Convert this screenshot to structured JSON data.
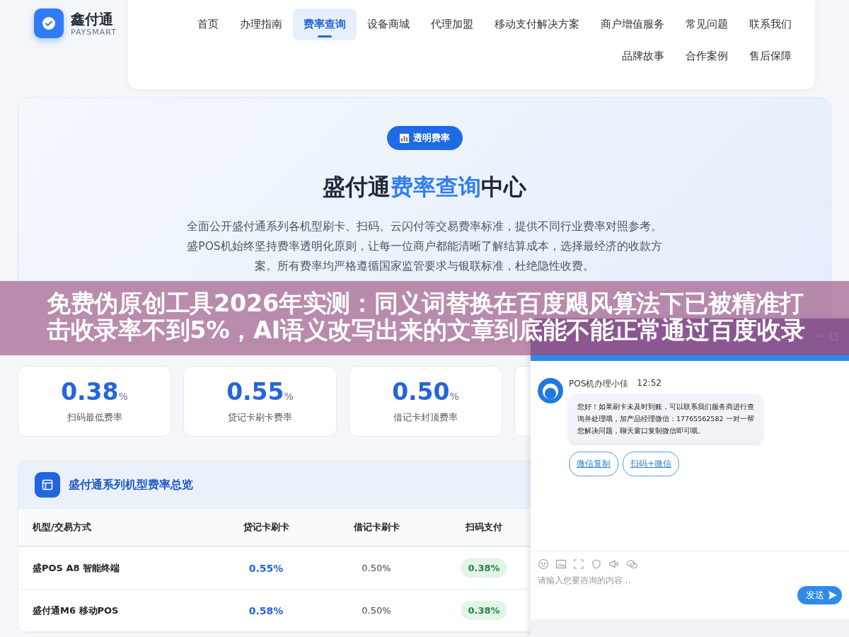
{
  "brand": {
    "name": "鑫付通",
    "tagline": "PAYSMART"
  },
  "nav": {
    "items": [
      {
        "label": "首页",
        "selected": false
      },
      {
        "label": "办理指南",
        "selected": false
      },
      {
        "label": "费率查询",
        "selected": true
      },
      {
        "label": "设备商城",
        "selected": false
      },
      {
        "label": "代理加盟",
        "selected": false
      },
      {
        "label": "移动支付解决方案",
        "selected": false
      },
      {
        "label": "商户增值服务",
        "selected": false
      },
      {
        "label": "常见问题",
        "selected": false
      },
      {
        "label": "联系我们",
        "selected": false
      },
      {
        "label": "品牌故事",
        "selected": false
      },
      {
        "label": "合作案例",
        "selected": false
      },
      {
        "label": "售后保障",
        "selected": false
      }
    ]
  },
  "hero": {
    "badge": "透明费率",
    "title": [
      {
        "text": "盛付通",
        "accent": false
      },
      {
        "text": "费率查询",
        "accent": true
      },
      {
        "text": "中心",
        "accent": false
      }
    ],
    "description": "全面公开盛付通系列各机型刷卡、扫码、云闪付等交易费率标准，提供不同行业费率对照参考。盛POS机始终坚持费率透明化原则，让每一位商户都能清晰了解结算成本，选择最经济的收款方案。所有费率均严格遵循国家监管要求与银联标准，杜绝隐性收费。"
  },
  "stats": [
    {
      "value": "0.38",
      "unit": "%",
      "label": "扫码最低费率"
    },
    {
      "value": "0.55",
      "unit": "%",
      "label": "贷记卡刷卡费率"
    },
    {
      "value": "0.50",
      "unit": "%",
      "label": "借记卡封顶费率"
    }
  ],
  "table": {
    "title": "盛付通系列机型费率总览",
    "columns": [
      "机型/交易方式",
      "贷记卡刷卡",
      "借记卡刷卡",
      "扫码支付"
    ],
    "rows": [
      [
        "盛POS A8 智能终端",
        "0.55%",
        "0.50%",
        "0.38%"
      ],
      [
        "盛付通M6 移动POS",
        "0.58%",
        "0.50%",
        "0.38%"
      ]
    ]
  },
  "banner": {
    "lines": [
      "免费伪原创工具2026年实测：同义词替换在百度飓风算法下已被精准打",
      "击收录率不到5%，AI语义改写出来的文章到底能不能正常通过百度收录"
    ]
  },
  "chat": {
    "agent": "POS机办理小佳",
    "time": "12:52",
    "message": "您好！如果刷卡未及时到账，可以联系我们服务商进行查询并处理哦，加产品经理微信：17765562582 一对一帮您解决问题，聊天窗口复制微信即可哦。",
    "quick_replies": [
      "微信复制",
      "扫码+微信"
    ],
    "placeholder": "请输入您要咨询的内容...",
    "send": "发送"
  }
}
